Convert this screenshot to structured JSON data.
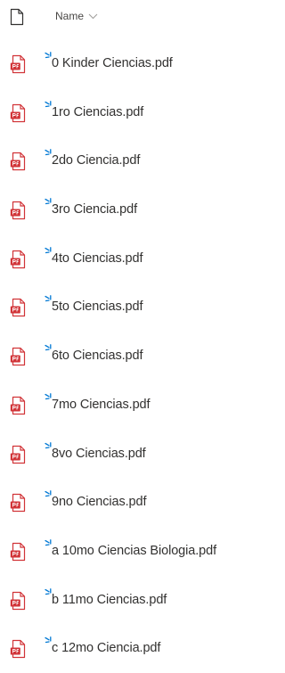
{
  "header": {
    "column_label": "Name",
    "file_type_icon": "document-icon",
    "sort_icon": "chevron-down-icon"
  },
  "files": [
    {
      "name": "0 Kinder Ciencias.pdf",
      "icon": "pdf-file-icon",
      "is_new": true
    },
    {
      "name": "1ro Ciencias.pdf",
      "icon": "pdf-file-icon",
      "is_new": true
    },
    {
      "name": "2do Ciencia.pdf",
      "icon": "pdf-file-icon",
      "is_new": true
    },
    {
      "name": "3ro Ciencia.pdf",
      "icon": "pdf-file-icon",
      "is_new": true
    },
    {
      "name": "4to Ciencias.pdf",
      "icon": "pdf-file-icon",
      "is_new": true
    },
    {
      "name": "5to Ciencias.pdf",
      "icon": "pdf-file-icon",
      "is_new": true
    },
    {
      "name": "6to Ciencias.pdf",
      "icon": "pdf-file-icon",
      "is_new": true
    },
    {
      "name": "7mo Ciencias.pdf",
      "icon": "pdf-file-icon",
      "is_new": true
    },
    {
      "name": "8vo Ciencias.pdf",
      "icon": "pdf-file-icon",
      "is_new": true
    },
    {
      "name": "9no Ciencias.pdf",
      "icon": "pdf-file-icon",
      "is_new": true
    },
    {
      "name": "a 10mo Ciencias Biologia.pdf",
      "icon": "pdf-file-icon",
      "is_new": true
    },
    {
      "name": "b 11mo Ciencias.pdf",
      "icon": "pdf-file-icon",
      "is_new": true
    },
    {
      "name": "c 12mo Ciencia.pdf",
      "icon": "pdf-file-icon",
      "is_new": true
    }
  ],
  "colors": {
    "pdf_red": "#d13438",
    "new_badge_blue": "#0078d4",
    "text": "#323130",
    "header_text": "#484644"
  }
}
